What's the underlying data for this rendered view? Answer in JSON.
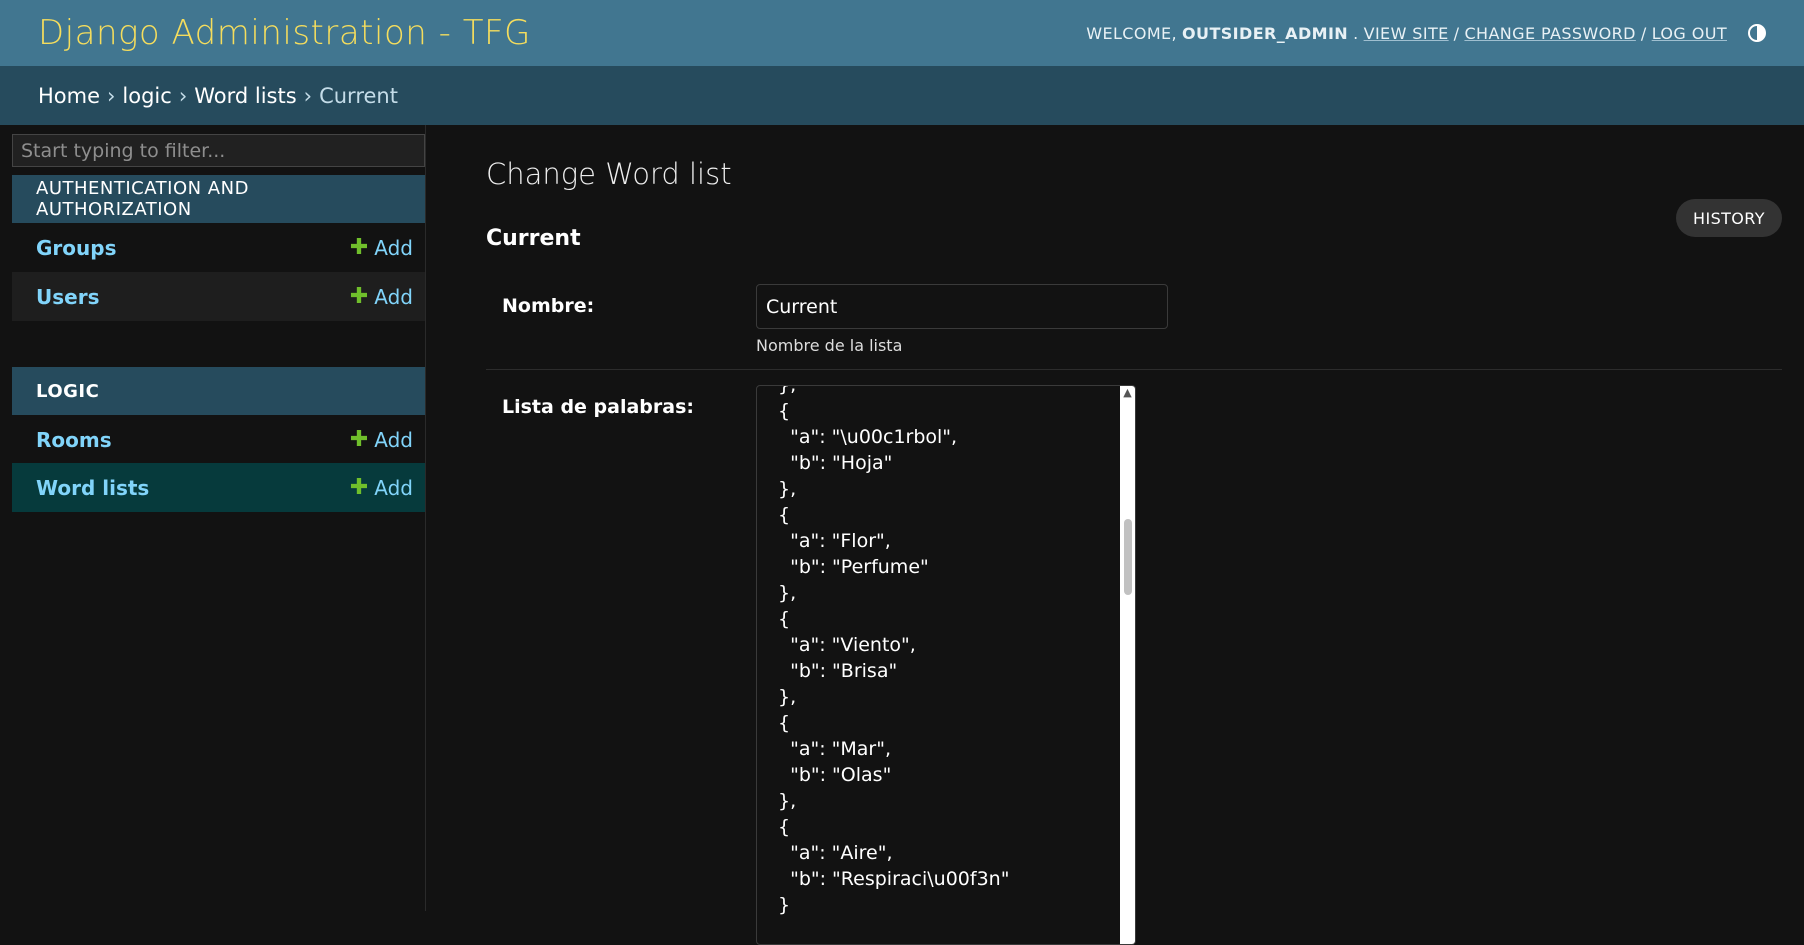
{
  "header": {
    "site_title": "Django Administration - TFG",
    "welcome": "Welcome,",
    "username": "outsider_admin",
    "view_site": "View site",
    "change_password": "Change password",
    "log_out": "Log out",
    "separator": "/",
    "theme_icon": "contrast-icon"
  },
  "breadcrumbs": {
    "home": "Home",
    "app": "logic",
    "model": "Word lists",
    "current": "Current",
    "separator": "›"
  },
  "sidebar": {
    "filter_placeholder": "Start typing to filter...",
    "modules": [
      {
        "caption": "Authentication and Authorization",
        "models": [
          {
            "name": "Groups",
            "add": "Add"
          },
          {
            "name": "Users",
            "add": "Add"
          }
        ]
      },
      {
        "caption": "Logic",
        "models": [
          {
            "name": "Rooms",
            "add": "Add"
          },
          {
            "name": "Word lists",
            "add": "Add"
          }
        ]
      }
    ],
    "active_model": "Word lists"
  },
  "content": {
    "title": "Change Word list",
    "history_label": "History",
    "object_name": "Current",
    "fields": {
      "nombre": {
        "label": "Nombre:",
        "value": "Current",
        "help": "Nombre de la lista"
      },
      "lista": {
        "label": "Lista de palabras:",
        "value": "},\n{\n  \"a\": \"\\u00c1rbol\",\n  \"b\": \"Hoja\"\n},\n{\n  \"a\": \"Flor\",\n  \"b\": \"Perfume\"\n},\n{\n  \"a\": \"Viento\",\n  \"b\": \"Brisa\"\n},\n{\n  \"a\": \"Mar\",\n  \"b\": \"Olas\"\n},\n{\n  \"a\": \"Aire\",\n  \"b\": \"Respiraci\\u00f3n\"\n}"
      }
    }
  },
  "colors": {
    "header_bg": "#417690",
    "breadcrumb_bg": "#264b5d",
    "site_title": "#f5dd5d",
    "link": "#81d4fa",
    "add_icon": "#70bf2b",
    "page_bg": "#121212",
    "active_row": "#063a3c"
  }
}
